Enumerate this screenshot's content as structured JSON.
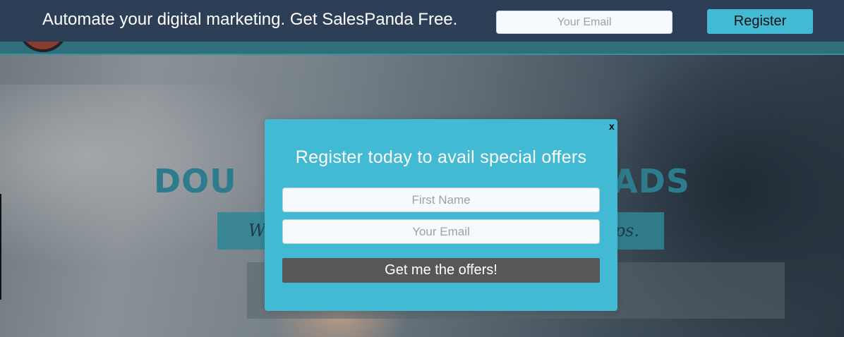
{
  "topbar": {
    "promo_text": "Automate your digital marketing. Get SalesPanda Free.",
    "email_placeholder": "Your Email",
    "register_label": "Register"
  },
  "background": {
    "heading_visible_left": "DOU",
    "heading_visible_right": "EADS",
    "subtitle_visible_left": "W",
    "subtitle_visible_right": "ps."
  },
  "modal": {
    "close_label": "x",
    "title": "Register today to avail special offers",
    "first_name_placeholder": "First Name",
    "email_placeholder": "Your Email",
    "submit_label": "Get me the offers!"
  },
  "colors": {
    "topbar_bg": "#2d3e57",
    "accent": "#43bad4",
    "submit_bg": "#575757",
    "header_teal": "#2f6f7c"
  }
}
